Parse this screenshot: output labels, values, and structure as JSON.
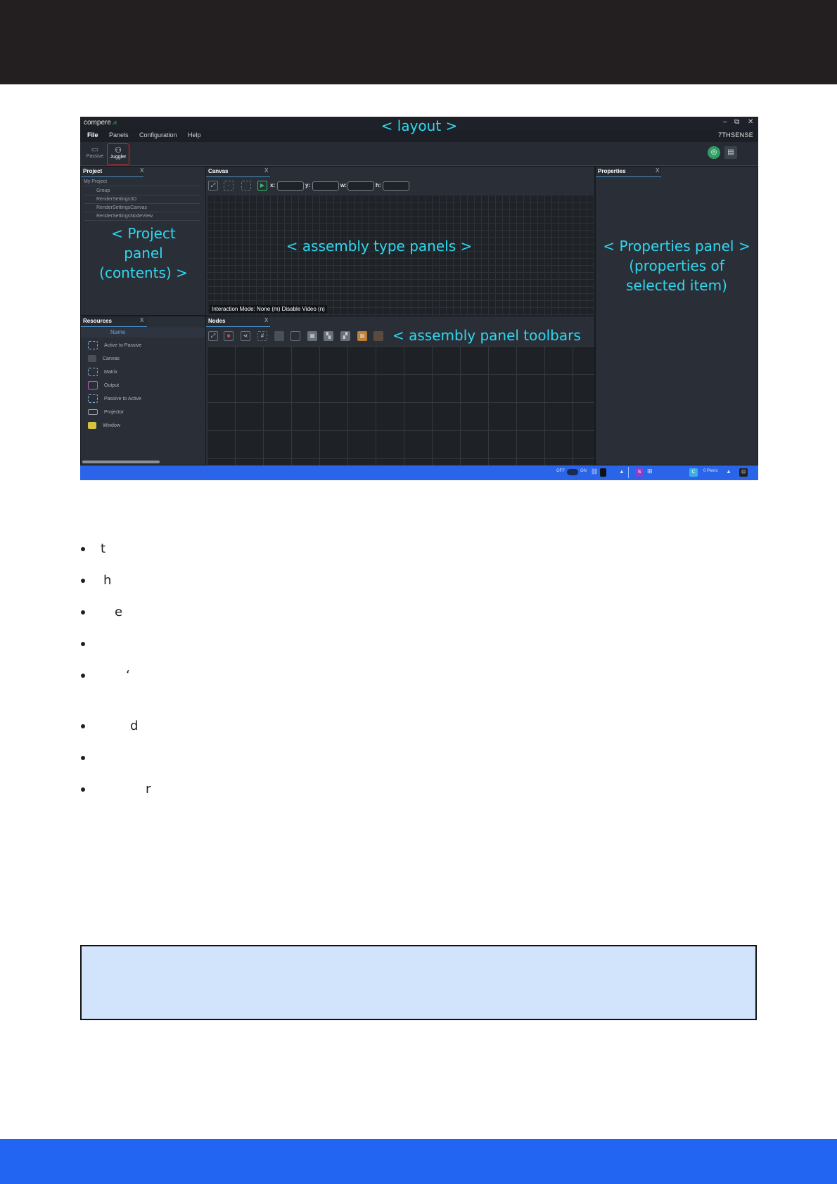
{
  "app": {
    "logo": "compere",
    "brand": "7THSENSE",
    "window_controls": [
      "–",
      "⧉",
      "✕"
    ],
    "menu": [
      "File",
      "Panels",
      "Configuration",
      "Help"
    ],
    "toolbar": {
      "passive": "Passive",
      "juggler": "Juggler"
    }
  },
  "project_panel": {
    "title": "Project",
    "close": "X",
    "items": [
      "My Project",
      "Group",
      "RenderSettings3D",
      "RenderSettingsCanvas",
      "RenderSettingsNodeView"
    ]
  },
  "resources_panel": {
    "title": "Resources",
    "close": "X",
    "column": "Name",
    "items": [
      "Active to Passive",
      "Canvas",
      "Matrix",
      "Output",
      "Passive to Active",
      "Projector",
      "Window"
    ]
  },
  "canvas_panel": {
    "title": "Canvas",
    "close": "X",
    "coords": [
      "x:",
      "y:",
      "w:",
      "h:"
    ],
    "interaction_mode": "Interaction Mode: None (m) Disable Video (n)"
  },
  "nodes_panel": {
    "title": "Nodes",
    "close": "X"
  },
  "properties_panel": {
    "title": "Properties",
    "close": "X"
  },
  "taskbar": {
    "off": "OFF",
    "on": "ON",
    "users": "0 Peers"
  },
  "annotations": {
    "layout": "< layout >",
    "project": [
      "< Project",
      "panel",
      "(contents) >"
    ],
    "assembly": "< assembly type panels >",
    "properties": [
      "< Properties panel >",
      "(properties of",
      "selected item)"
    ],
    "toolbars": "< assembly panel toolbars"
  },
  "bullets": [
    "t",
    "h",
    "e",
    "",
    "‘",
    "d",
    "",
    "r"
  ],
  "colors": {
    "top_band": "#231f20",
    "bottom_band": "#2265f2",
    "annotation": "#2fd8f0",
    "note_box": "#d2e3fc"
  }
}
